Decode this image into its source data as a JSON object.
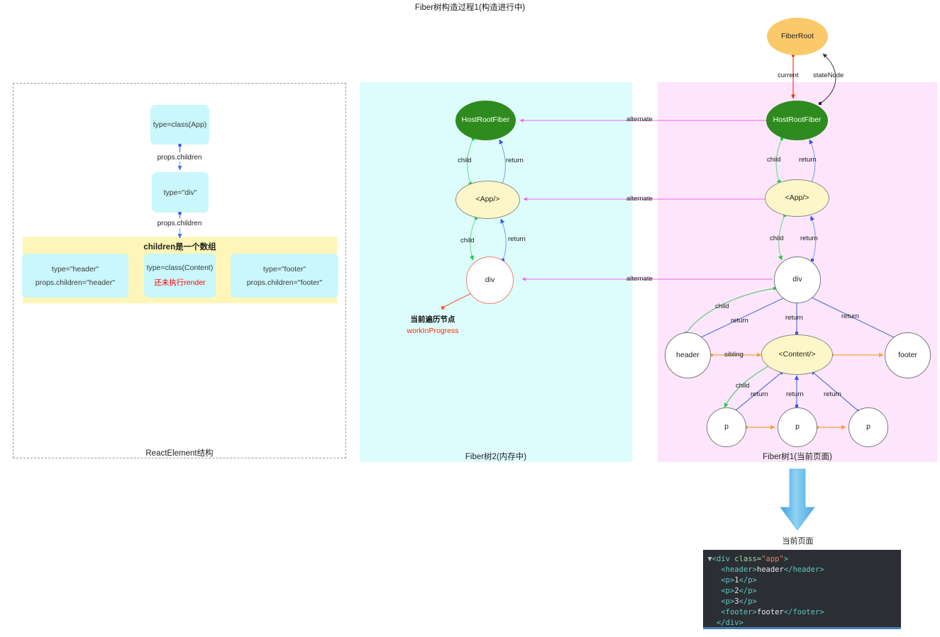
{
  "page": {
    "title": "Fiber树构造过程1(构造进行中)"
  },
  "react_element_panel": {
    "caption": "ReactElement结构",
    "nodes": [
      {
        "id": "app",
        "text": "type=class(App)"
      },
      {
        "id": "div",
        "text": "type=\"div\""
      }
    ],
    "edge_labels": [
      "props.children",
      "props.children"
    ],
    "children_band": {
      "title": "children是一个数组",
      "items": [
        {
          "line1": "type=\"header\"",
          "line2": "props.children=\"header\"",
          "line2_red": false
        },
        {
          "line1": "type=class(Content)",
          "line2": "还未执行render",
          "line2_red": true
        },
        {
          "line1": "type=\"footer\"",
          "line2": "props.children=\"footer\"",
          "line2_red": false
        }
      ]
    }
  },
  "fiber2_panel": {
    "caption": "Fiber树2(内存中)",
    "nodes": [
      {
        "id": "hostrootfiber",
        "label": "HostRootFiber",
        "shape": "ellipse",
        "fill": "#2e8b1e"
      },
      {
        "id": "app",
        "label": "<App/>",
        "shape": "ellipse",
        "fill": "#fdf6c8"
      },
      {
        "id": "div",
        "label": "div",
        "shape": "circle",
        "fill": "#ffffff"
      }
    ],
    "edge_labels": [
      "child",
      "return",
      "child",
      "return"
    ],
    "annotation": {
      "line1": "当前遍历节点",
      "line2": "workInProgress"
    }
  },
  "fiber1_panel": {
    "caption": "Fiber树1(当前页面)",
    "root_node": {
      "label": "FiberRoot",
      "fill": "#fbc96a"
    },
    "root_edges": [
      {
        "label": "current",
        "color": "#ff2b00"
      },
      {
        "label": "stateNode",
        "color": "#333333"
      }
    ],
    "nodes": [
      {
        "id": "hostrootfiber",
        "label": "HostRootFiber",
        "fill": "#2e8b1e"
      },
      {
        "id": "app",
        "label": "<App/>",
        "fill": "#fdf6c8"
      },
      {
        "id": "div",
        "label": "div",
        "fill": "#ffffff"
      },
      {
        "id": "header",
        "label": "header",
        "fill": "#ffffff"
      },
      {
        "id": "content",
        "label": "<Content/>",
        "fill": "#fdf6c8"
      },
      {
        "id": "footer",
        "label": "footer",
        "fill": "#ffffff"
      },
      {
        "id": "p1",
        "label": "p",
        "fill": "#ffffff"
      },
      {
        "id": "p2",
        "label": "p",
        "fill": "#ffffff"
      },
      {
        "id": "p3",
        "label": "p",
        "fill": "#ffffff"
      }
    ],
    "edge_labels": {
      "child_1": "child",
      "return_1": "return",
      "child_2": "child",
      "return_2": "return",
      "child_3": "child",
      "return_3": "return",
      "return_4": "return",
      "return_5": "return",
      "sibling_1": "sibling",
      "child_4": "child",
      "return_6": "return",
      "return_7": "return",
      "return_8": "return"
    }
  },
  "alternate_links": {
    "label_top": "alternate",
    "label_mid": "alternate",
    "label_bottom": "alternate",
    "color": "#ee66ee"
  },
  "current_page": {
    "label": "当前页面",
    "arrow_color": "#5bb4e8"
  },
  "code_block": {
    "caret": "▼",
    "lines": [
      {
        "indent": 2,
        "caret": true,
        "segments": [
          {
            "text": "<div ",
            "cls": "c-tag"
          },
          {
            "text": "class=",
            "cls": "c-attr"
          },
          {
            "text": "\"app\"",
            "cls": "c-str"
          },
          {
            "text": ">",
            "cls": "c-tag"
          }
        ]
      },
      {
        "indent": 4,
        "caret": false,
        "segments": [
          {
            "text": "<header>",
            "cls": "c-tag"
          },
          {
            "text": "header",
            "cls": "c-txt"
          },
          {
            "text": "</header>",
            "cls": "c-tag"
          }
        ]
      },
      {
        "indent": 4,
        "caret": false,
        "segments": [
          {
            "text": "<p>",
            "cls": "c-tag"
          },
          {
            "text": "1",
            "cls": "c-txt"
          },
          {
            "text": "</p>",
            "cls": "c-tag"
          }
        ]
      },
      {
        "indent": 4,
        "caret": false,
        "segments": [
          {
            "text": "<p>",
            "cls": "c-tag"
          },
          {
            "text": "2",
            "cls": "c-txt"
          },
          {
            "text": "</p>",
            "cls": "c-tag"
          }
        ]
      },
      {
        "indent": 4,
        "caret": false,
        "segments": [
          {
            "text": "<p>",
            "cls": "c-tag"
          },
          {
            "text": "3",
            "cls": "c-txt"
          },
          {
            "text": "</p>",
            "cls": "c-tag"
          }
        ]
      },
      {
        "indent": 4,
        "caret": false,
        "segments": [
          {
            "text": "<footer>",
            "cls": "c-tag"
          },
          {
            "text": "footer",
            "cls": "c-txt"
          },
          {
            "text": "</footer>",
            "cls": "c-tag"
          }
        ]
      },
      {
        "indent": 3,
        "caret": false,
        "segments": [
          {
            "text": "</div>",
            "cls": "c-tag"
          }
        ]
      }
    ]
  }
}
